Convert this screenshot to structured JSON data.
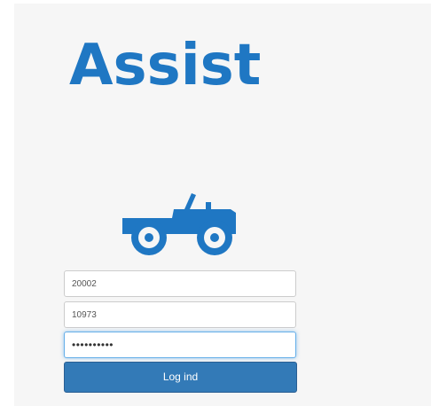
{
  "logo": {
    "text": "Assist",
    "color": "#1f77c3",
    "icon": "jeep-icon"
  },
  "form": {
    "username_value": "20002",
    "pin_value": "10973",
    "password_value": "••••••••••",
    "submit_label": "Log ind",
    "button_color": "#337ab7"
  }
}
